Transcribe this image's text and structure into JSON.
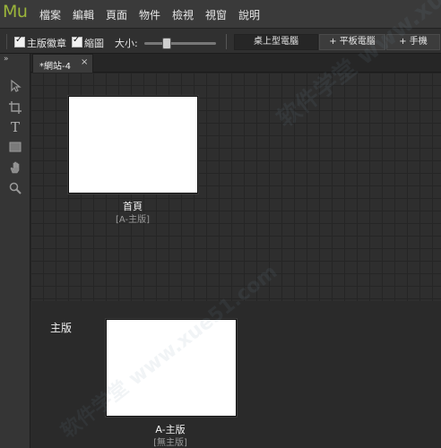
{
  "app": {
    "logo": "Mu"
  },
  "menu": {
    "items": [
      {
        "label": "檔案"
      },
      {
        "label": "編輯"
      },
      {
        "label": "頁面"
      },
      {
        "label": "物件"
      },
      {
        "label": "檢視"
      },
      {
        "label": "視窗"
      },
      {
        "label": "說明"
      }
    ]
  },
  "options": {
    "master_badges_label": "主版徽章",
    "master_badges_checked": true,
    "thumbnails_label": "縮圖",
    "thumbnails_checked": true,
    "size_label": "大小:",
    "size_level": 0.3,
    "breakpoints": [
      {
        "label": "桌上型電腦",
        "active": true
      },
      {
        "label": "+ 平板電腦",
        "active": false
      },
      {
        "label": "+ 手機",
        "active": false
      }
    ]
  },
  "panel": {
    "collapse_glyph": "»"
  },
  "tab": {
    "label": "*網站-4",
    "close": "×"
  },
  "tools": [
    {
      "icon": "selection-arrow-icon"
    },
    {
      "icon": "crop-icon"
    },
    {
      "icon": "text-tool-icon",
      "glyph": "T"
    },
    {
      "icon": "rectangle-icon"
    },
    {
      "icon": "hand-icon"
    },
    {
      "icon": "zoom-icon"
    }
  ],
  "pages": [
    {
      "name": "首頁",
      "master": "[A-主版]"
    }
  ],
  "masters_section": {
    "label": "主版",
    "items": [
      {
        "name": "A-主版",
        "master": "[無主版]"
      }
    ]
  },
  "watermark": {
    "text": "软件学堂 www.xue51.com"
  }
}
